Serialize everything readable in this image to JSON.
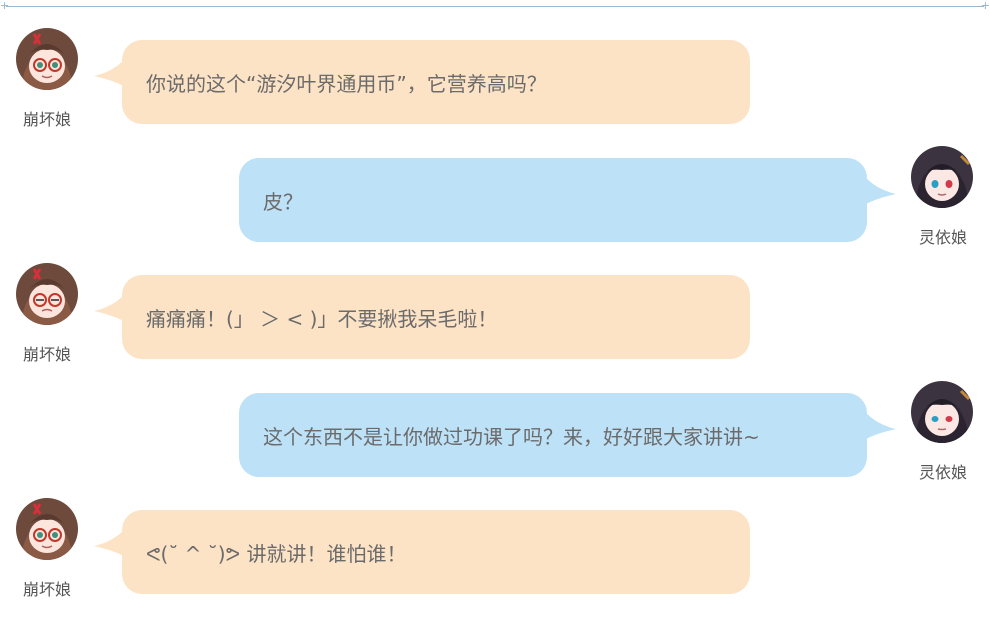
{
  "messages": [
    {
      "side": "left",
      "speaker": "崩坏娘",
      "avatar_icon": "honkai-girl-avatar-icon",
      "text": "你说的这个“游汐叶界通用币”，它营养高吗？"
    },
    {
      "side": "right",
      "speaker": "灵依娘",
      "avatar_icon": "lingyi-girl-avatar-icon",
      "text": "皮？"
    },
    {
      "side": "left",
      "speaker": "崩坏娘",
      "avatar_icon": "honkai-girl-avatar-icon",
      "text": "痛痛痛！(」 ＞ < )」不要揪我呆毛啦！"
    },
    {
      "side": "right",
      "speaker": "灵依娘",
      "avatar_icon": "lingyi-girl-avatar-icon",
      "text": "这个东西不是让你做过功课了吗？来，好好跟大家讲讲~"
    },
    {
      "side": "left",
      "speaker": "崩坏娘",
      "avatar_icon": "honkai-girl-avatar-icon",
      "text": "ᕙ(˘ ^ ˘)ᕗ 讲就讲！谁怕谁！"
    }
  ],
  "colors": {
    "left_bubble": "#fde3c6",
    "right_bubble": "#bde1f7",
    "text": "#6b6b6b",
    "rule": "#9ab8cf"
  }
}
